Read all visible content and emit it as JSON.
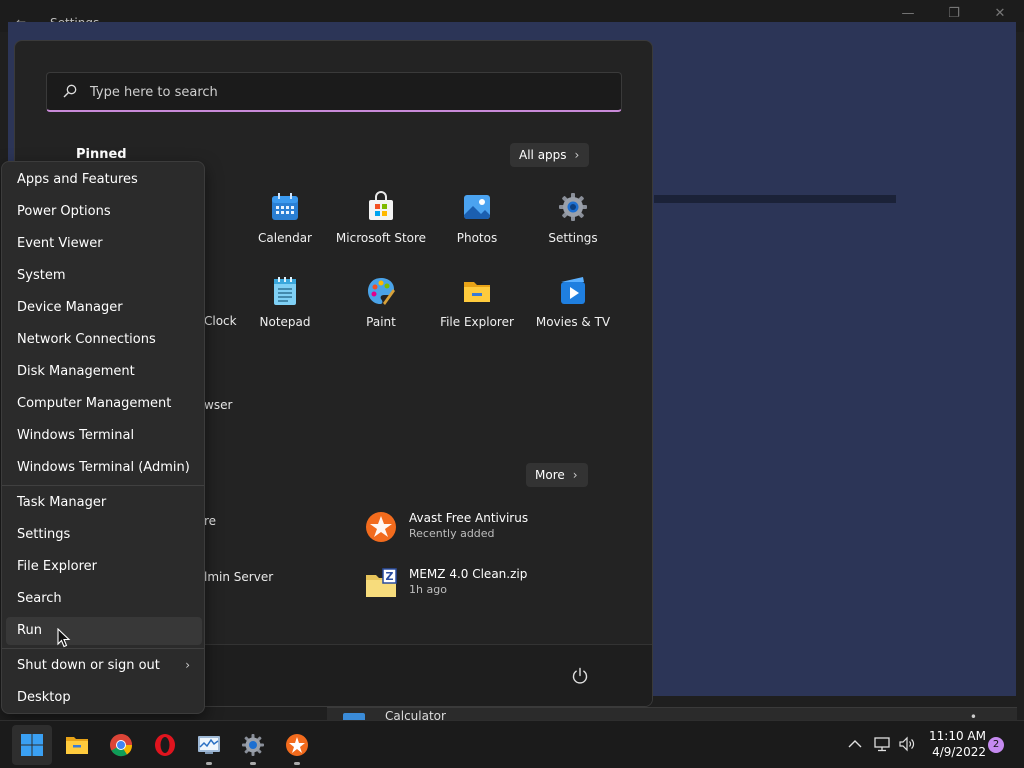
{
  "background_window": {
    "title": "Settings",
    "back_glyph": "←",
    "minimize_glyph": "—",
    "restore_glyph": "❐",
    "close_glyph": "✕"
  },
  "background_list": {
    "visible_item": "Calculator"
  },
  "start_menu": {
    "search_placeholder": "Type here to search",
    "pinned_title": "Pinned",
    "all_apps_label": "All apps",
    "more_label": "More",
    "pinned_apps": [
      {
        "label": "Calendar",
        "icon": "calendar-icon"
      },
      {
        "label": "Microsoft Store",
        "icon": "store-icon"
      },
      {
        "label": "Photos",
        "icon": "photos-icon"
      },
      {
        "label": "Settings",
        "icon": "settings-gear-icon"
      },
      {
        "label": "Notepad",
        "icon": "notepad-icon"
      },
      {
        "label": "Paint",
        "icon": "paint-palette-icon"
      },
      {
        "label": "File Explorer",
        "icon": "folder-icon"
      },
      {
        "label": "Movies & TV",
        "icon": "movies-play-icon"
      }
    ],
    "partial_labels": [
      "Clock",
      "wser",
      "re",
      "lmin Server"
    ],
    "recommended": [
      {
        "title": "Avast Free Antivirus",
        "subtitle": "Recently added",
        "icon": "avast-icon"
      },
      {
        "title": "MEMZ 4.0 Clean.zip",
        "subtitle": "1h ago",
        "icon": "zip-folder-icon"
      }
    ]
  },
  "context_menu": {
    "group1": [
      "Apps and Features",
      "Power Options",
      "Event Viewer",
      "System",
      "Device Manager",
      "Network Connections",
      "Disk Management",
      "Computer Management",
      "Windows Terminal",
      "Windows Terminal (Admin)"
    ],
    "group2": [
      "Task Manager",
      "Settings",
      "File Explorer",
      "Search",
      "Run"
    ],
    "group3": [
      "Shut down or sign out",
      "Desktop"
    ],
    "hovered_item": "Run"
  },
  "taskbar": {
    "apps": [
      "start-windows-icon",
      "file-explorer-icon",
      "chrome-icon",
      "opera-icon",
      "resource-monitor-icon",
      "settings-icon",
      "avast-icon"
    ],
    "time": "11:10 AM",
    "date": "4/9/2022",
    "notification_count": "2"
  },
  "colors": {
    "accent": "#c98ad8",
    "windows_blue": "#1e90e8",
    "bg_content": "#2c3557"
  }
}
